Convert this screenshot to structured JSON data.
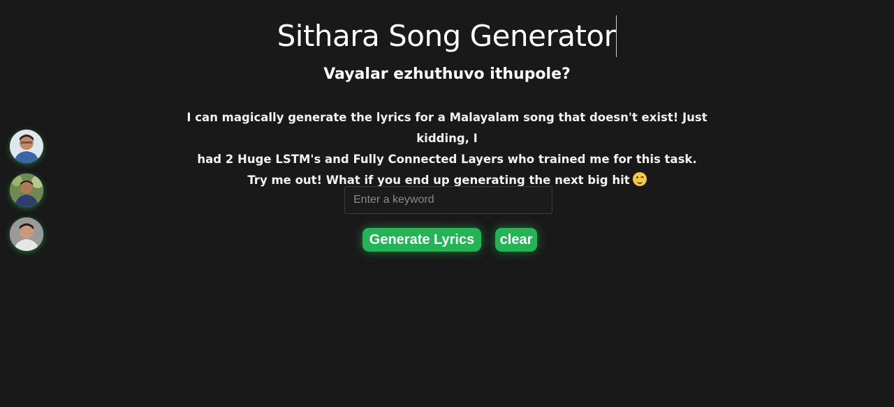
{
  "header": {
    "title": "Sithara Song Generator",
    "subtitle": "Vayalar ezhuthuvo ithupole?"
  },
  "description": {
    "line1": "I can magically generate the lyrics for a Malayalam song that doesn't exist! Just kidding, I",
    "line2": "had 2 Huge LSTM's and Fully Connected Layers who trained me for this task.",
    "line3": "Try me out! What if you end up generating the next big hit",
    "emoji_icon": "winking-face-emoji"
  },
  "search": {
    "value": "",
    "placeholder": "Enter a keyword"
  },
  "buttons": {
    "generate_label": "Generate Lyrics",
    "clear_label": "clear"
  },
  "avatars": [
    {
      "icon": "profile-photo"
    },
    {
      "icon": "profile-photo"
    },
    {
      "icon": "profile-photo"
    }
  ],
  "colors": {
    "background": "#191919",
    "accent": "#22b455",
    "text": "#ffffff"
  }
}
